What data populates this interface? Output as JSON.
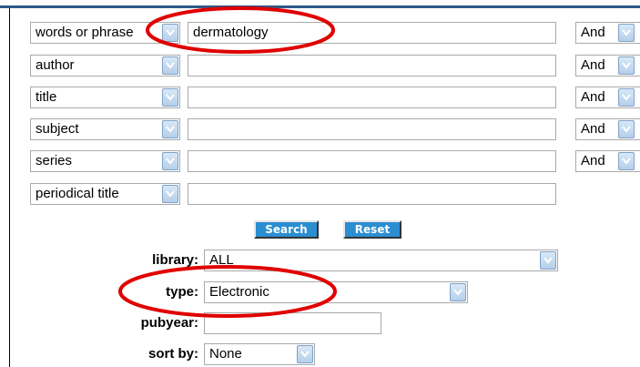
{
  "search_rows": [
    {
      "field": "words or phrase",
      "value": "dermatology",
      "operator": "And"
    },
    {
      "field": "author",
      "value": "",
      "operator": "And"
    },
    {
      "field": "title",
      "value": "",
      "operator": "And"
    },
    {
      "field": "subject",
      "value": "",
      "operator": "And"
    },
    {
      "field": "series",
      "value": "",
      "operator": "And"
    },
    {
      "field": "periodical title",
      "value": ""
    }
  ],
  "buttons": {
    "search": "Search",
    "reset": "Reset"
  },
  "filters": {
    "library": {
      "label": "library:",
      "value": "ALL"
    },
    "type": {
      "label": "type:",
      "value": "Electronic"
    },
    "pubyear": {
      "label": "pubyear:",
      "value": ""
    },
    "sort_by": {
      "label": "sort by:",
      "value": "None"
    }
  },
  "colors": {
    "highlight": "#e00000",
    "button": "#2b8ed1",
    "dropdown_arrow": "#b5cfe9",
    "top_bar": "#2e5a88"
  },
  "icons": {
    "dropdown": "chevron-down-icon"
  }
}
